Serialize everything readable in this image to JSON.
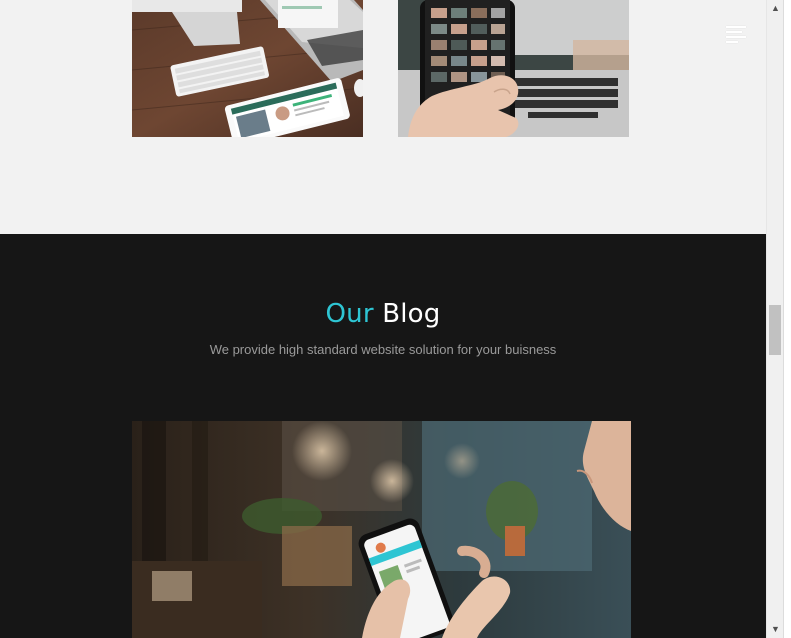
{
  "nav": {
    "menu_icon": "hamburger-menu-icon"
  },
  "portfolio": {
    "images": [
      {
        "icon": "desk-workspace-photo",
        "alt": "Desk with iMac, keyboard, laptop and tablet"
      },
      {
        "icon": "smartphone-photo",
        "alt": "Hand holding smartphone in front of laptop"
      }
    ]
  },
  "blog": {
    "title_accent": "Our",
    "title_rest": "Blog",
    "subtitle": "We provide high standard website solution for your buisness",
    "image": {
      "icon": "person-with-phone-photo",
      "alt": "Person using smartphone in cafe"
    }
  },
  "scrollbar": {
    "up_arrow": "▲",
    "down_arrow": "▼"
  },
  "colors": {
    "accent": "#2ec5d3",
    "dark_bg": "#161616",
    "light_bg": "#f2f2f2"
  }
}
